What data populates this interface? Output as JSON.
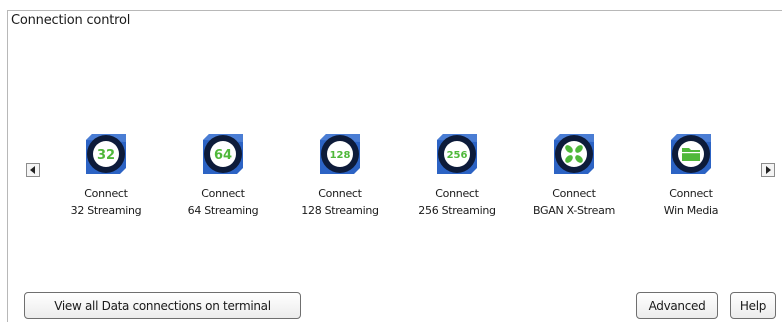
{
  "panel": {
    "title": "Connection control"
  },
  "connections": [
    {
      "line1": "Connect",
      "line2": "32 Streaming",
      "icon_text": "32",
      "icon": "streaming-32-icon"
    },
    {
      "line1": "Connect",
      "line2": "64 Streaming",
      "icon_text": "64",
      "icon": "streaming-64-icon"
    },
    {
      "line1": "Connect",
      "line2": "128 Streaming",
      "icon_text": "128",
      "icon": "streaming-128-icon"
    },
    {
      "line1": "Connect",
      "line2": "256 Streaming",
      "icon_text": "256",
      "icon": "streaming-256-icon"
    },
    {
      "line1": "Connect",
      "line2": "BGAN X-Stream",
      "icon": "bgan-x-stream-icon"
    },
    {
      "line1": "Connect",
      "line2": "Win Media",
      "icon": "folder-icon"
    }
  ],
  "buttons": {
    "view_all": "View all Data connections on terminal",
    "advanced": "Advanced",
    "help": "Help"
  },
  "colors": {
    "icon_dark": "#0d1b3a",
    "icon_blue": "#2c63c4",
    "icon_green": "#4fb83a"
  }
}
